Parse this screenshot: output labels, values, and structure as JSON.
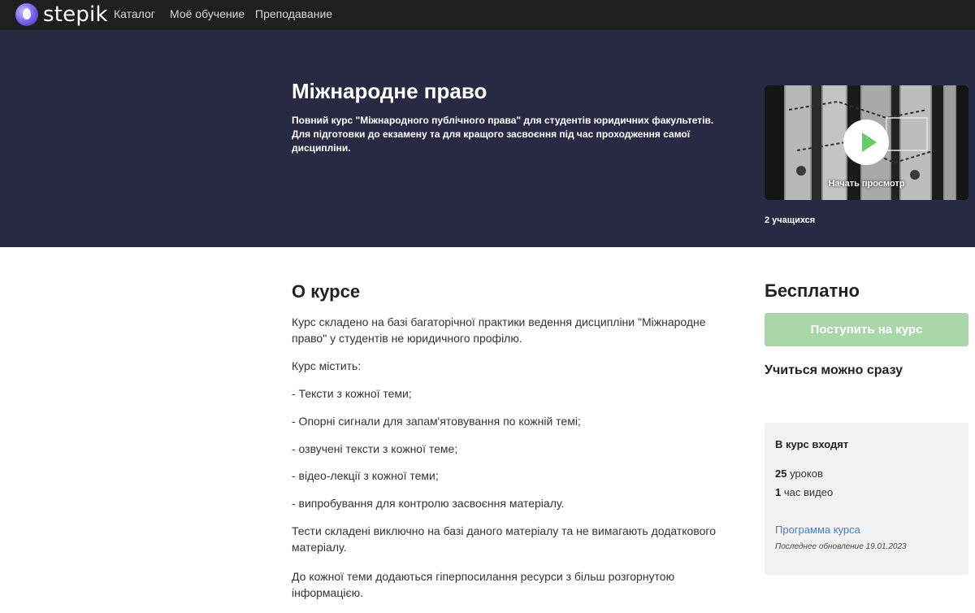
{
  "nav": {
    "logo_text": "stepik",
    "links": [
      "Каталог",
      "Моё обучение",
      "Преподавание"
    ]
  },
  "hero": {
    "title": "Міжнародне право",
    "summary": "Повний курс \"Міжнародного публічного права\" для студентів юридичних факультетів. Для підготовки до екзамену та для кращого засвоєння під час проходження самої дисципліни.",
    "preview_label": "Начать просмотр",
    "learners": "2 учащихся"
  },
  "about": {
    "title": "О курсе",
    "paragraphs": [
      "Курс складено на базі багаторічної практики ведення дисципліни \"Міжнародне право\" у студентів не юридичного профілю.",
      "Курс містить:",
      "- Тексти з кожної теми;",
      "- Опорні сигнали для запам'ятовування по кожній темі;",
      "- озвучені тексти з кожної теме;",
      "- відео-лекції з кожної теми;",
      "- випробування для контролю засвоєння матеріалу.",
      "Тести складені виключно на базі даного матеріалу та не вимагають додаткового матеріалу.",
      "До кожної теми додаються гіперпосилання ресурси з більш розгорнутою інформацією."
    ]
  },
  "sidebar": {
    "price": "Бесплатно",
    "enroll_label": "Поступить на курс",
    "learn_now": "Учиться можно сразу",
    "includes": {
      "title": "В курс входят",
      "lessons_count": "25",
      "lessons_label": " уроков",
      "video_count": "1",
      "video_label": " час видео",
      "program_link": "Программа курса",
      "updated": "Последнее обновление 19.01.2023"
    }
  },
  "colors": {
    "nav_bg": "#1f1f1f",
    "hero_bg": "#282a43",
    "enroll_disabled": "#a8d8a8",
    "play_icon": "#66cc66",
    "link": "#3f7fd8",
    "box_bg": "#f2f2f2"
  }
}
